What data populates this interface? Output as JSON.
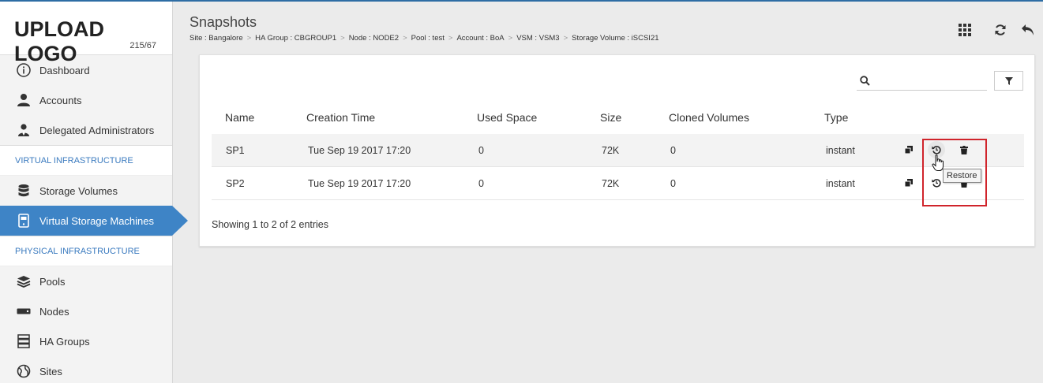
{
  "logo": {
    "text": "UPLOAD LOGO",
    "sub": "215/67"
  },
  "sidebar": {
    "items_top": [
      {
        "label": "Dashboard",
        "icon": "info-icon"
      },
      {
        "label": "Accounts",
        "icon": "user-icon"
      },
      {
        "label": "Delegated Administrators",
        "icon": "admin-icon"
      }
    ],
    "section_virtual": "VIRTUAL INFRASTRUCTURE",
    "items_virtual": [
      {
        "label": "Storage Volumes",
        "icon": "database-icon"
      },
      {
        "label": "Virtual Storage Machines",
        "icon": "vsm-icon",
        "active": true
      }
    ],
    "section_physical": "PHYSICAL INFRASTRUCTURE",
    "items_physical": [
      {
        "label": "Pools",
        "icon": "layers-icon"
      },
      {
        "label": "Nodes",
        "icon": "server-icon"
      },
      {
        "label": "HA Groups",
        "icon": "stack-icon"
      },
      {
        "label": "Sites",
        "icon": "globe-icon"
      }
    ]
  },
  "header": {
    "title": "Snapshots",
    "breadcrumb": [
      "Site : Bangalore",
      "HA Group : CBGROUP1",
      "Node : NODE2",
      "Pool : test",
      "Account : BoA",
      "VSM : VSM3",
      "Storage Volume : iSCSI21"
    ],
    "icons": [
      "grid-icon",
      "refresh-icon",
      "back-icon"
    ]
  },
  "search": {
    "placeholder": "",
    "value": ""
  },
  "table": {
    "columns": [
      "Name",
      "Creation Time",
      "Used Space",
      "Size",
      "Cloned Volumes",
      "Type"
    ],
    "rows": [
      {
        "name": "SP1",
        "creation_time": "Tue Sep 19 2017 17:20",
        "used_space": "0",
        "size": "72K",
        "cloned_volumes": "0",
        "type": "instant"
      },
      {
        "name": "SP2",
        "creation_time": "Tue Sep 19 2017 17:20",
        "used_space": "0",
        "size": "72K",
        "cloned_volumes": "0",
        "type": "instant"
      }
    ],
    "actions": [
      "clone-icon",
      "restore-icon",
      "delete-icon"
    ],
    "info": "Showing 1 to 2 of 2 entries"
  },
  "tooltip": "Restore",
  "colors": {
    "accent": "#3e84c6",
    "highlight": "#d0242b",
    "section": "#3a7abf"
  }
}
